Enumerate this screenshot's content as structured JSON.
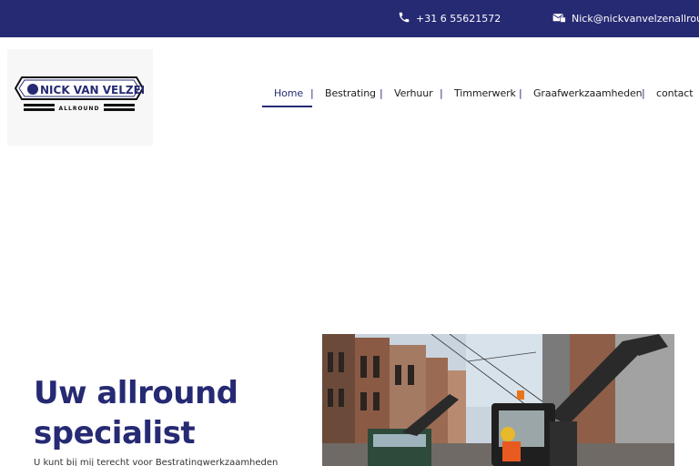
{
  "topbar": {
    "phone_icon": "phone-icon",
    "phone": "+31 6 55621572",
    "mail_icon": "mail-icon",
    "email": "Nick@nickvanvelzenallround"
  },
  "logo": {
    "name": "NICK VAN VELZEN",
    "tagline": "ALLROUND"
  },
  "nav": {
    "items": [
      {
        "label": "Home",
        "active": true
      },
      {
        "label": "Bestrating"
      },
      {
        "label": "Verhuur"
      },
      {
        "label": "Timmerwerk"
      },
      {
        "label": "Graafwerkzaamheden"
      },
      {
        "label": "contact"
      }
    ],
    "separator": "|"
  },
  "hero": {
    "title_line1": "Uw allround",
    "title_line2": "specialist",
    "subtitle": "U kunt bij mij terecht voor Bestratingwerkzaamheden"
  },
  "colors": {
    "brand": "#262a73",
    "topbar": "#262a73"
  }
}
